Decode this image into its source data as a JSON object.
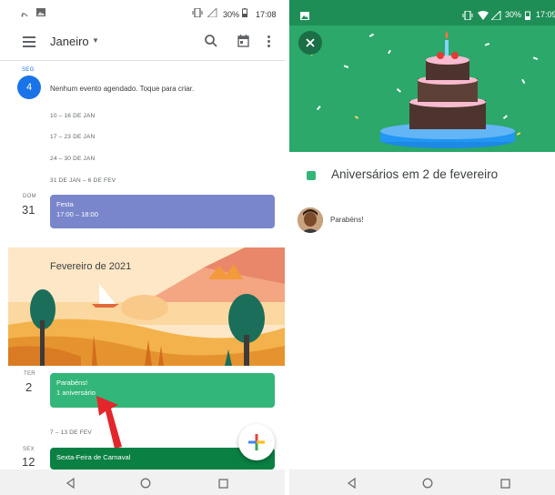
{
  "colors": {
    "accent_blue": "#1a73e8",
    "event_festa": "#7986cb",
    "event_green": "#33b679",
    "event_teal": "#0b8043",
    "hero_green": "#2ba86a",
    "status_green": "#1e8e56"
  },
  "left": {
    "status": {
      "battery": "30%",
      "time": "17:08",
      "icons": [
        "cast-icon",
        "image-icon",
        "vibrate-icon",
        "signal-icon",
        "battery-icon"
      ]
    },
    "appbar": {
      "month": "Janeiro",
      "icons": [
        "menu-icon",
        "caret-down-icon",
        "search-icon",
        "calendar-today-icon",
        "more-vert-icon"
      ]
    },
    "day1": {
      "label": "SEG",
      "num": "4",
      "text": "Nenhum evento agendado. Toque para criar."
    },
    "weeks": [
      "10 – 16 DE JAN",
      "17 – 23 DE JAN",
      "24 – 30 DE JAN",
      "31 DE JAN – 6 DE FEV"
    ],
    "day2": {
      "label": "DOM",
      "num": "31",
      "event_title": "Festa",
      "event_time": "17:00 – 18:00"
    },
    "banner": {
      "title": "Fevereiro de 2021"
    },
    "day3": {
      "label": "TER",
      "num": "2",
      "event_title": "Parabéns!",
      "event_sub": "1 aniversário"
    },
    "week_after": "7 – 13 DE FEV",
    "day4": {
      "label": "SEX",
      "num": "12",
      "event_title": "Sexta-Feira de Carnaval"
    },
    "fab": {
      "icon": "plus-icon"
    }
  },
  "right": {
    "status": {
      "battery": "30%",
      "time": "17:09"
    },
    "close_icon": "close-icon",
    "title": "Aniversários em 2 de fevereiro",
    "person_message": "Parabéns!"
  },
  "nav": {
    "icons": [
      "back-icon",
      "home-icon",
      "recents-icon"
    ]
  }
}
